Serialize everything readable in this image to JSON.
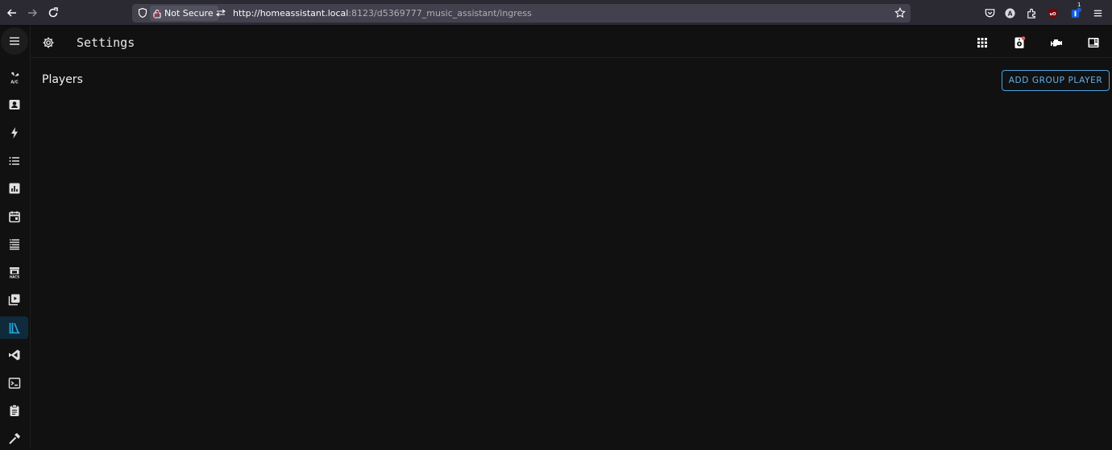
{
  "browser": {
    "not_secure_label": "Not Secure",
    "url_host": "http://homeassistant.local",
    "url_rest": ":8123/d5369777_music_assistant/ingress",
    "nav_icons": [
      "back-arrow-icon",
      "forward-arrow-icon",
      "reload-icon"
    ],
    "extension_icons": [
      "pocket-icon",
      "account-icon",
      "extensions-icon",
      "ublock-icon",
      "bitwarden-icon",
      "hamburger-menu-icon"
    ],
    "badge_count": "1"
  },
  "sidebar": {
    "items": [
      {
        "icon": "air-conditioner-icon",
        "label": "A/C"
      },
      {
        "icon": "account-box-icon"
      },
      {
        "icon": "lightning-bolt-icon"
      },
      {
        "icon": "format-list-icon"
      },
      {
        "icon": "chart-box-icon"
      },
      {
        "icon": "calendar-icon"
      },
      {
        "icon": "database-icon"
      },
      {
        "icon": "hacs-store-icon",
        "label": "HACS"
      },
      {
        "icon": "play-box-multiple-icon"
      },
      {
        "icon": "library-music-icon",
        "active": true
      },
      {
        "icon": "vscode-icon"
      },
      {
        "icon": "console-icon"
      },
      {
        "icon": "clipboard-list-icon"
      },
      {
        "icon": "hammer-icon"
      }
    ],
    "active_color": "#29a8e0"
  },
  "toolbar": {
    "title": "Settings",
    "icons": [
      "apps-grid-icon",
      "speaker-icon",
      "engine-icon",
      "display-icon"
    ]
  },
  "main": {
    "section_title": "Players",
    "add_group_button": "ADD GROUP PLAYER"
  },
  "colors": {
    "accent": "#4aa3df",
    "background": "#111111",
    "notification_dot": "#e45b5b"
  }
}
